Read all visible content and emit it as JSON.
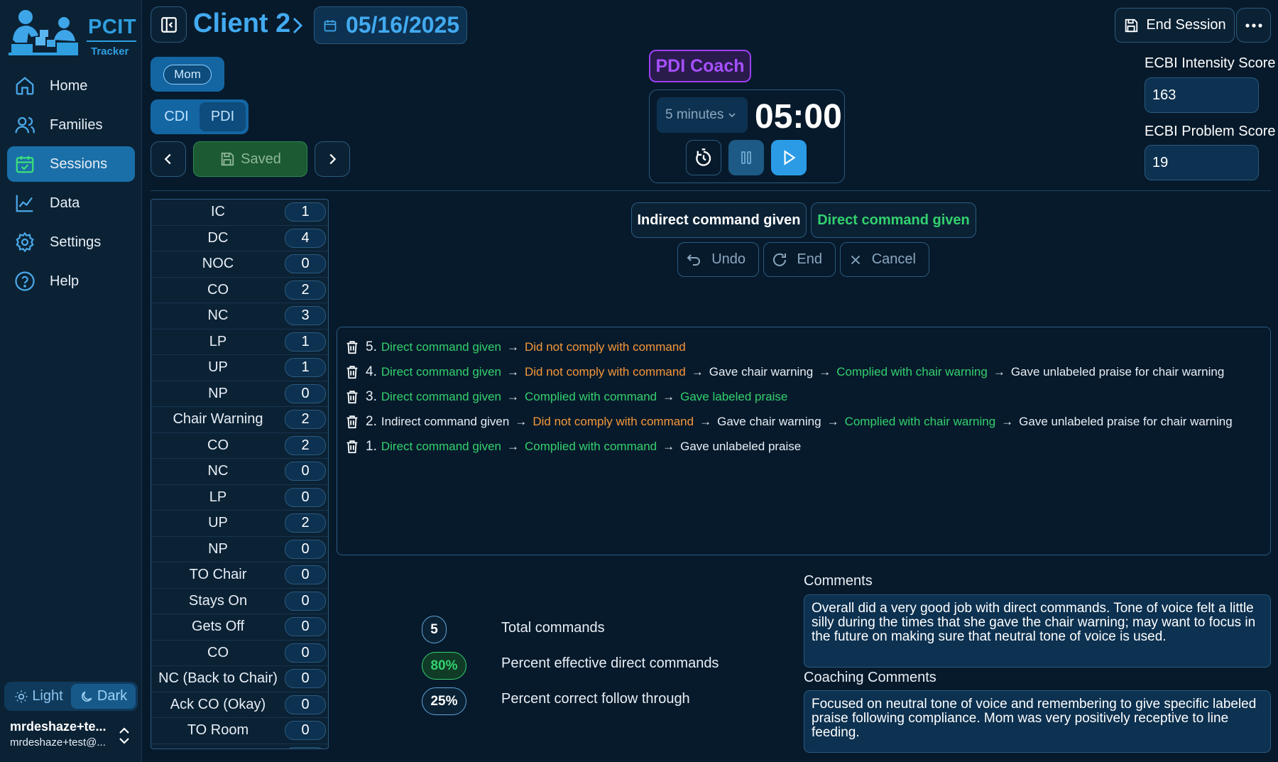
{
  "brand": {
    "name": "PCIT",
    "sub": "Tracker"
  },
  "nav": [
    {
      "label": "Home",
      "icon": "home-icon",
      "active": false
    },
    {
      "label": "Families",
      "icon": "users-icon",
      "active": false
    },
    {
      "label": "Sessions",
      "icon": "calendar-check-icon",
      "active": true
    },
    {
      "label": "Data",
      "icon": "line-chart-icon",
      "active": false
    },
    {
      "label": "Settings",
      "icon": "gear-icon",
      "active": false
    },
    {
      "label": "Help",
      "icon": "help-circle-icon",
      "active": false
    }
  ],
  "theme": {
    "light": "Light",
    "dark": "Dark",
    "selected": "dark"
  },
  "user": {
    "name": "mrdeshaze+te...",
    "email": "mrdeshaze+test@..."
  },
  "header": {
    "client": "Client 2",
    "date": "05/16/2025",
    "end_session": "End Session"
  },
  "controls": {
    "parent": "Mom",
    "modes": [
      "CDI",
      "PDI"
    ],
    "selected_mode": "PDI",
    "save_status": "Saved"
  },
  "counts": [
    {
      "label": "IC",
      "value": "1"
    },
    {
      "label": "DC",
      "value": "4"
    },
    {
      "label": "NOC",
      "value": "0"
    },
    {
      "label": "CO",
      "value": "2"
    },
    {
      "label": "NC",
      "value": "3"
    },
    {
      "label": "LP",
      "value": "1"
    },
    {
      "label": "UP",
      "value": "1"
    },
    {
      "label": "NP",
      "value": "0"
    },
    {
      "label": "Chair Warning",
      "value": "2"
    },
    {
      "label": "CO",
      "value": "2"
    },
    {
      "label": "NC",
      "value": "0"
    },
    {
      "label": "LP",
      "value": "0"
    },
    {
      "label": "UP",
      "value": "2"
    },
    {
      "label": "NP",
      "value": "0"
    },
    {
      "label": "TO Chair",
      "value": "0"
    },
    {
      "label": "Stays On",
      "value": "0"
    },
    {
      "label": "Gets Off",
      "value": "0"
    },
    {
      "label": "CO",
      "value": "0"
    },
    {
      "label": "NC (Back to Chair)",
      "value": "0"
    },
    {
      "label": "Ack CO (Okay)",
      "value": "0"
    },
    {
      "label": "TO Room",
      "value": "0"
    },
    {
      "label": "",
      "value": ""
    }
  ],
  "timer": {
    "coach_badge": "PDI Coach",
    "duration": "5 minutes",
    "display": "05:00"
  },
  "ecbi": {
    "intensity_label": "ECBI Intensity Score",
    "intensity_value": "163",
    "problem_label": "ECBI Problem Score",
    "problem_value": "19"
  },
  "commands": {
    "indirect": "Indirect command given",
    "direct": "Direct command given",
    "undo": "Undo",
    "end": "End",
    "cancel": "Cancel"
  },
  "colors": {
    "green": "#33d16e",
    "orange": "#f5973a",
    "white": "#e8eef5",
    "accent": "#42aaf0",
    "coach": "#a650ff"
  },
  "log": [
    {
      "num": "5.",
      "steps": [
        {
          "text": "Direct command given",
          "tone": "green"
        },
        {
          "text": "Did not comply with command",
          "tone": "orange"
        }
      ]
    },
    {
      "num": "4.",
      "steps": [
        {
          "text": "Direct command given",
          "tone": "green"
        },
        {
          "text": "Did not comply with command",
          "tone": "orange"
        },
        {
          "text": "Gave chair warning",
          "tone": "white"
        },
        {
          "text": "Complied with chair warning",
          "tone": "green"
        },
        {
          "text": "Gave unlabeled praise for chair warning",
          "tone": "white"
        }
      ]
    },
    {
      "num": "3.",
      "steps": [
        {
          "text": "Direct command given",
          "tone": "green"
        },
        {
          "text": "Complied with command",
          "tone": "green"
        },
        {
          "text": "Gave labeled praise",
          "tone": "green"
        }
      ]
    },
    {
      "num": "2.",
      "steps": [
        {
          "text": "Indirect command given",
          "tone": "white"
        },
        {
          "text": "Did not comply with command",
          "tone": "orange"
        },
        {
          "text": "Gave chair warning",
          "tone": "white"
        },
        {
          "text": "Complied with chair warning",
          "tone": "green"
        },
        {
          "text": "Gave unlabeled praise for chair warning",
          "tone": "white"
        }
      ]
    },
    {
      "num": "1.",
      "steps": [
        {
          "text": "Direct command given",
          "tone": "green"
        },
        {
          "text": "Complied with command",
          "tone": "green"
        },
        {
          "text": "Gave unlabeled praise",
          "tone": "white"
        }
      ]
    }
  ],
  "stats": [
    {
      "value": "5",
      "label": "Total commands",
      "tone": "white"
    },
    {
      "value": "80%",
      "label": "Percent effective direct commands",
      "tone": "green"
    },
    {
      "value": "25%",
      "label": "Percent correct follow through",
      "tone": "white"
    }
  ],
  "comments": {
    "label": "Comments",
    "text": "Overall did a very good job with direct commands. Tone of voice felt a little silly during the times that she gave the chair warning; may want to focus in the future on making sure that neutral tone of voice is used.",
    "coaching_label": "Coaching Comments",
    "coaching_text": "Focused on neutral tone of voice and remembering to give specific labeled praise following compliance. Mom was very positively receptive to line feeding."
  }
}
